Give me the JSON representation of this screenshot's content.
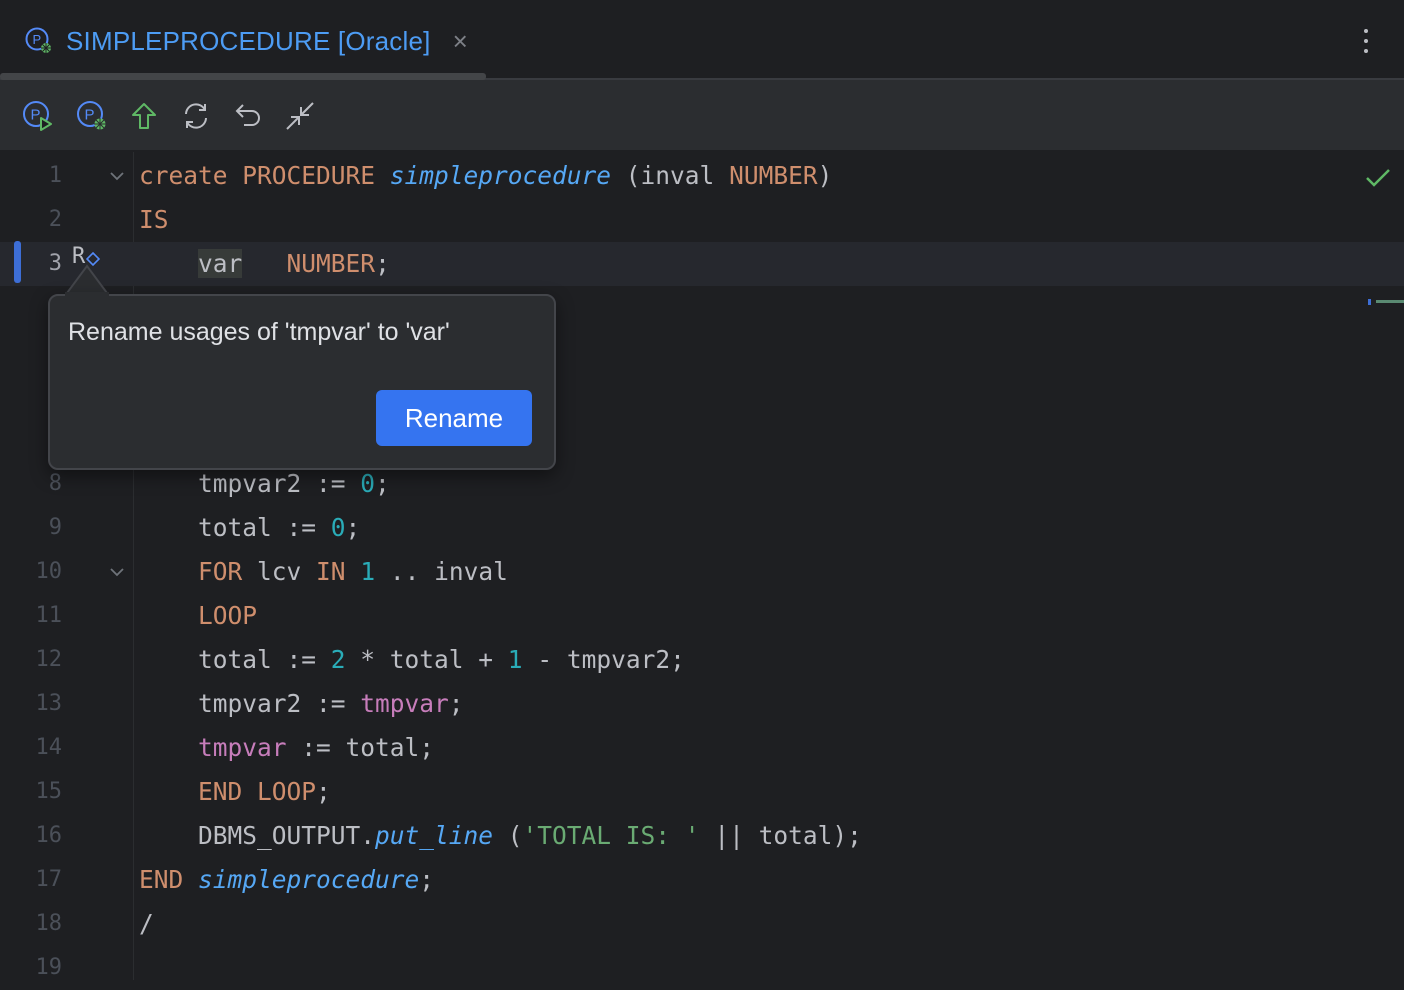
{
  "tab": {
    "title": "SIMPLEPROCEDURE [Oracle]",
    "close_glyph": "×"
  },
  "toolbar": {
    "buttons": [
      "run-procedure-icon",
      "debug-procedure-icon",
      "submit-arrow-icon",
      "refresh-icon",
      "revert-icon",
      "collapse-icon"
    ]
  },
  "editor": {
    "line_numbers": [
      "1",
      "2",
      "3",
      "8",
      "9",
      "10",
      "11",
      "12",
      "13",
      "14",
      "15",
      "16",
      "17",
      "18",
      "19"
    ],
    "rename_gutter_glyph": "R"
  },
  "popup": {
    "message": "Rename usages of 'tmpvar' to 'var'",
    "button_label": "Rename"
  },
  "colors": {
    "accent": "#3574f0",
    "keyword": "#cf8e6d",
    "function": "#56a8f5",
    "number": "#2aacb8",
    "string": "#6aab73",
    "variable": "#c77dbb",
    "check": "#5fb865"
  },
  "code_lines": [
    [
      [
        "create ",
        "kw"
      ],
      [
        "PROCEDURE ",
        "kw"
      ],
      [
        "simpleprocedure",
        "fn"
      ],
      [
        " (inval ",
        ""
      ],
      [
        "NUMBER",
        "kw"
      ],
      [
        ")",
        ""
      ]
    ],
    [
      [
        "IS",
        "kw"
      ]
    ],
    [
      [
        "    ",
        ""
      ],
      [
        "var",
        "hl"
      ],
      [
        "   ",
        ""
      ],
      [
        "NUMBER",
        "kw"
      ],
      [
        ";",
        ""
      ]
    ],
    [
      [
        "    tmpvar2 := ",
        ""
      ],
      [
        "0",
        "num"
      ],
      [
        ";",
        ""
      ]
    ],
    [
      [
        "    total := ",
        ""
      ],
      [
        "0",
        "num"
      ],
      [
        ";",
        ""
      ]
    ],
    [
      [
        "    ",
        ""
      ],
      [
        "FOR",
        "kw"
      ],
      [
        " lcv ",
        ""
      ],
      [
        "IN",
        "kw"
      ],
      [
        " ",
        ""
      ],
      [
        "1",
        "num"
      ],
      [
        " .. inval",
        ""
      ]
    ],
    [
      [
        "    ",
        ""
      ],
      [
        "LOOP",
        "kw"
      ]
    ],
    [
      [
        "    total := ",
        ""
      ],
      [
        "2",
        "num"
      ],
      [
        " * total + ",
        ""
      ],
      [
        "1",
        "num"
      ],
      [
        " - tmpvar2;",
        ""
      ]
    ],
    [
      [
        "    tmpvar2 := ",
        ""
      ],
      [
        "tmpvar",
        "var"
      ],
      [
        ";",
        ""
      ]
    ],
    [
      [
        "    ",
        ""
      ],
      [
        "tmpvar",
        "var"
      ],
      [
        " := total;",
        ""
      ]
    ],
    [
      [
        "    ",
        ""
      ],
      [
        "END LOOP",
        "kw"
      ],
      [
        ";",
        ""
      ]
    ],
    [
      [
        "    DBMS_OUTPUT.",
        ""
      ],
      [
        "put_line",
        "fn"
      ],
      [
        " (",
        ""
      ],
      [
        "'TOTAL IS: '",
        "str"
      ],
      [
        " || total);",
        ""
      ]
    ],
    [
      [
        "END ",
        "kw"
      ],
      [
        "simpleprocedure",
        "fn"
      ],
      [
        ";",
        ""
      ]
    ],
    [
      [
        "/",
        ""
      ]
    ],
    []
  ]
}
